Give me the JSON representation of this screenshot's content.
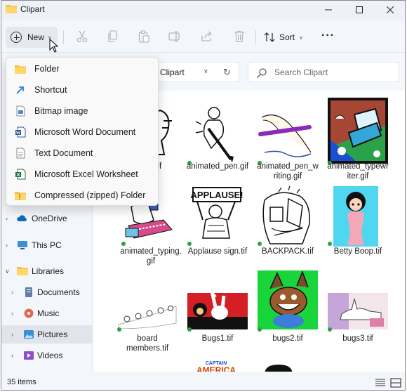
{
  "window": {
    "title": "Clipart"
  },
  "toolbar": {
    "new_label": "New",
    "sort_label": "Sort",
    "icons": [
      "cut-icon",
      "copy-icon",
      "paste-icon",
      "rename-icon",
      "share-icon",
      "delete-icon"
    ]
  },
  "address": {
    "text": "Clipart"
  },
  "search": {
    "placeholder": "Search Clipart"
  },
  "new_menu": {
    "items": [
      {
        "label": "Folder",
        "icon": "folder-icon"
      },
      {
        "label": "Shortcut",
        "icon": "shortcut-icon"
      },
      {
        "label": "Bitmap image",
        "icon": "bitmap-icon"
      },
      {
        "label": "Microsoft Word Document",
        "icon": "word-icon"
      },
      {
        "label": "Text Document",
        "icon": "text-document-icon"
      },
      {
        "label": "Microsoft Excel Worksheet",
        "icon": "excel-icon"
      },
      {
        "label": "Compressed (zipped) Folder",
        "icon": "zip-folder-icon"
      }
    ]
  },
  "sidebar": {
    "items": [
      {
        "label": "OneDrive",
        "icon": "onedrive-icon"
      },
      {
        "label": "This PC",
        "icon": "pc-icon"
      },
      {
        "label": "Libraries",
        "icon": "libraries-icon"
      },
      {
        "label": "Documents",
        "icon": "documents-icon"
      },
      {
        "label": "Music",
        "icon": "music-icon"
      },
      {
        "label": "Pictures",
        "icon": "pictures-icon"
      },
      {
        "label": "Videos",
        "icon": "videos-icon"
      }
    ]
  },
  "files": [
    {
      "name": "...n.tif",
      "display": "n.tif"
    },
    {
      "name": "animated_pen.gif",
      "display": "animated_pen.gif"
    },
    {
      "name": "animated_pen_writing.gif",
      "line1": "animated_pen_w",
      "line2": "riting.gif"
    },
    {
      "name": "animated_typewriter.gif",
      "line1": "animated_typewr",
      "line2": "iter.gif"
    },
    {
      "name": "animated_typing.gif",
      "line1": "animated_typing.",
      "line2": "gif"
    },
    {
      "name": "Applause sign.tif",
      "display": "Applause sign.tif"
    },
    {
      "name": "BACKPACK.tif",
      "display": "BACKPACK.tif"
    },
    {
      "name": "Betty Boop.tif",
      "display": "Betty Boop.tif"
    },
    {
      "name": "board members.tif",
      "line1": "board",
      "line2": "members.tif"
    },
    {
      "name": "Bugs1.tif",
      "display": "Bugs1.tif"
    },
    {
      "name": "bugs2.tif",
      "display": "bugs2.tif"
    },
    {
      "name": "bugs3.tif",
      "display": "bugs3.tif"
    }
  ],
  "thumb_text": {
    "applause": "APPLAUSE!",
    "captain_line1": "CAPTAIN",
    "captain_line2": "AMERICA"
  },
  "status": {
    "count": "35 items"
  },
  "colors": {
    "accent": "#0067c0",
    "sync_green": "#2ea043",
    "folder_yellow": "#f5c342"
  }
}
